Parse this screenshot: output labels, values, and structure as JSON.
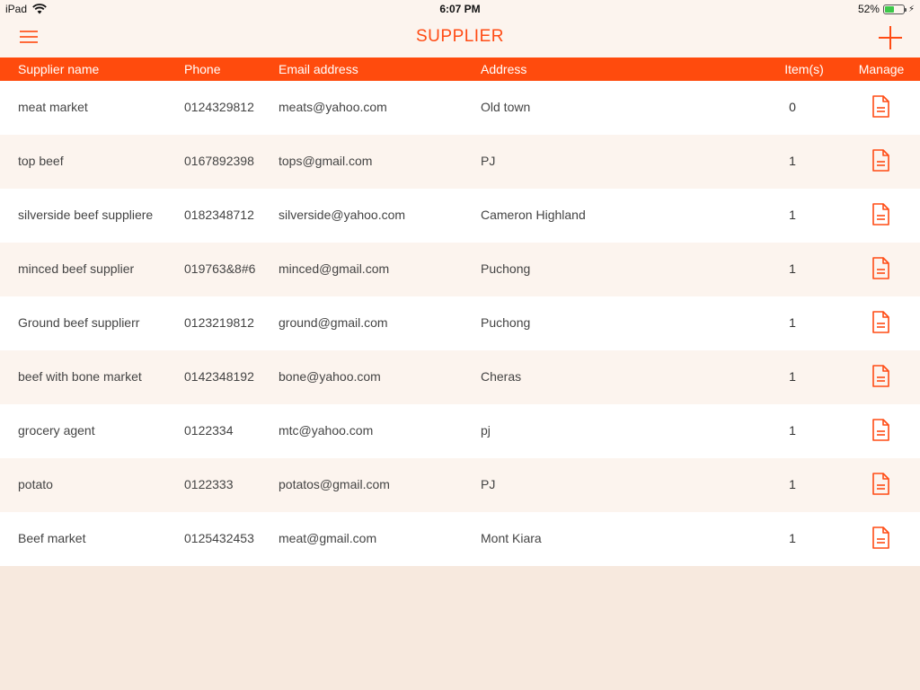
{
  "status_bar": {
    "device": "iPad",
    "time": "6:07 PM",
    "battery": "52%",
    "battery_level": 0.52,
    "icons": [
      "wifi-icon",
      "battery-icon",
      "charging-bolt-icon"
    ]
  },
  "nav": {
    "title": "SUPPLIER",
    "icons": [
      "hamburger-menu-icon",
      "add-icon"
    ]
  },
  "colors": {
    "accent": "#ff4b0d",
    "row_alt": "#fcf4ee",
    "background": "#f7e9de"
  },
  "table": {
    "headers": {
      "name": "Supplier name",
      "phone": "Phone",
      "email": "Email address",
      "address": "Address",
      "items": "Item(s)",
      "manage": "Manage"
    },
    "manage_icon": "document-icon",
    "rows": [
      {
        "name": "meat market",
        "phone": "0124329812",
        "email": "meats@yahoo.com",
        "address": "Old town",
        "items": "0"
      },
      {
        "name": "top beef",
        "phone": "0167892398",
        "email": "tops@gmail.com",
        "address": "PJ",
        "items": "1"
      },
      {
        "name": "silverside beef suppliere",
        "phone": "0182348712",
        "email": "silverside@yahoo.com",
        "address": "Cameron Highland",
        "items": "1"
      },
      {
        "name": "minced beef supplier",
        "phone": "019763&8#6",
        "email": "minced@gmail.com",
        "address": "Puchong",
        "items": "1"
      },
      {
        "name": "Ground beef supplierr",
        "phone": "0123219812",
        "email": "ground@gmail.com",
        "address": "Puchong",
        "items": "1"
      },
      {
        "name": "beef with bone market",
        "phone": "0142348192",
        "email": "bone@yahoo.com",
        "address": "Cheras",
        "items": "1"
      },
      {
        "name": "grocery agent",
        "phone": "0122334",
        "email": "mtc@yahoo.com",
        "address": "pj",
        "items": "1"
      },
      {
        "name": "potato",
        "phone": "0122333",
        "email": "potatos@gmail.com",
        "address": "PJ",
        "items": "1"
      },
      {
        "name": "Beef market",
        "phone": "0125432453",
        "email": "meat@gmail.com",
        "address": "Mont Kiara",
        "items": "1"
      }
    ]
  }
}
